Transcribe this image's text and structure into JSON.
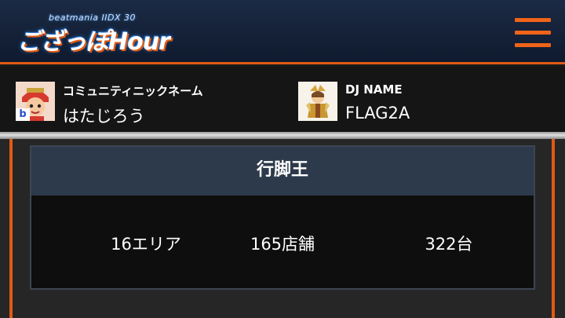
{
  "header": {
    "logo_top": "beatmania IIDX 30",
    "logo_main": "ござっぽHour"
  },
  "user": {
    "community_label": "コミュニティニックネーム",
    "community_value": "はたじろう",
    "avatar_badge": "b",
    "dj_label": "DJ NAME",
    "dj_value": "FLAG2A"
  },
  "card": {
    "title": "行脚王",
    "stats": [
      "16エリア",
      "165店舗",
      "322台"
    ]
  },
  "colors": {
    "accent": "#e05a14",
    "header_bg": "#1b2a44",
    "card_head_bg": "#2d3a4b"
  }
}
